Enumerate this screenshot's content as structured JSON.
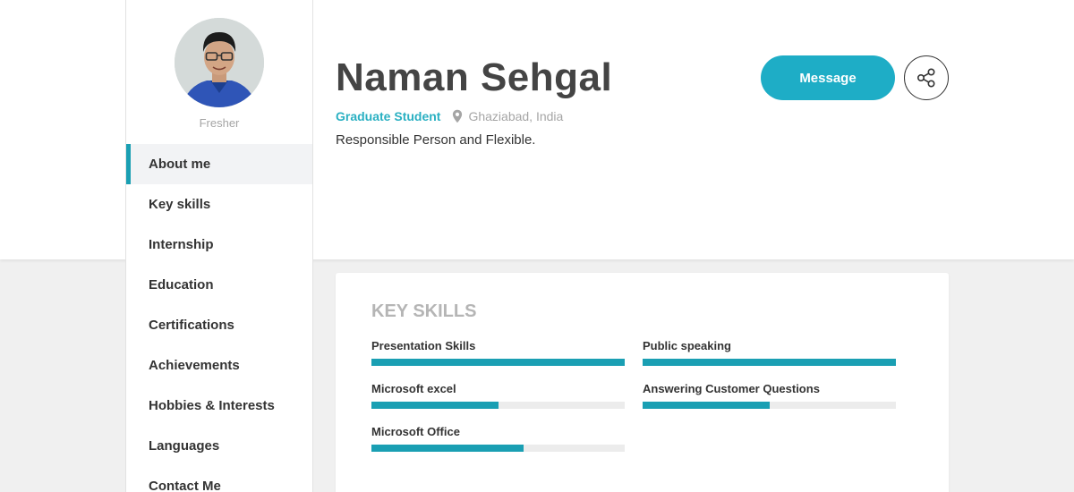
{
  "profile": {
    "role": "Fresher",
    "name": "Naman Sehgal",
    "designation": "Graduate Student",
    "location": "Ghaziabad, India",
    "tagline": "Responsible Person and Flexible."
  },
  "actions": {
    "message_label": "Message",
    "share_icon": "share-icon"
  },
  "nav": {
    "items": [
      {
        "label": "About me",
        "active": true
      },
      {
        "label": "Key skills"
      },
      {
        "label": "Internship"
      },
      {
        "label": "Education"
      },
      {
        "label": "Certifications"
      },
      {
        "label": "Achievements"
      },
      {
        "label": "Hobbies & Interests"
      },
      {
        "label": "Languages"
      },
      {
        "label": "Contact Me"
      }
    ]
  },
  "skills": {
    "title": "KEY SKILLS",
    "items": [
      {
        "name": "Presentation Skills",
        "level": 1.0
      },
      {
        "name": "Public speaking",
        "level": 1.0
      },
      {
        "name": "Microsoft excel",
        "level": 0.5
      },
      {
        "name": "Answering Customer Questions",
        "level": 0.5
      },
      {
        "name": "Microsoft Office",
        "level": 0.6
      }
    ]
  },
  "colors": {
    "accent": "#1a9fb3",
    "button": "#1eadc6",
    "designation": "#2ab0c2"
  }
}
